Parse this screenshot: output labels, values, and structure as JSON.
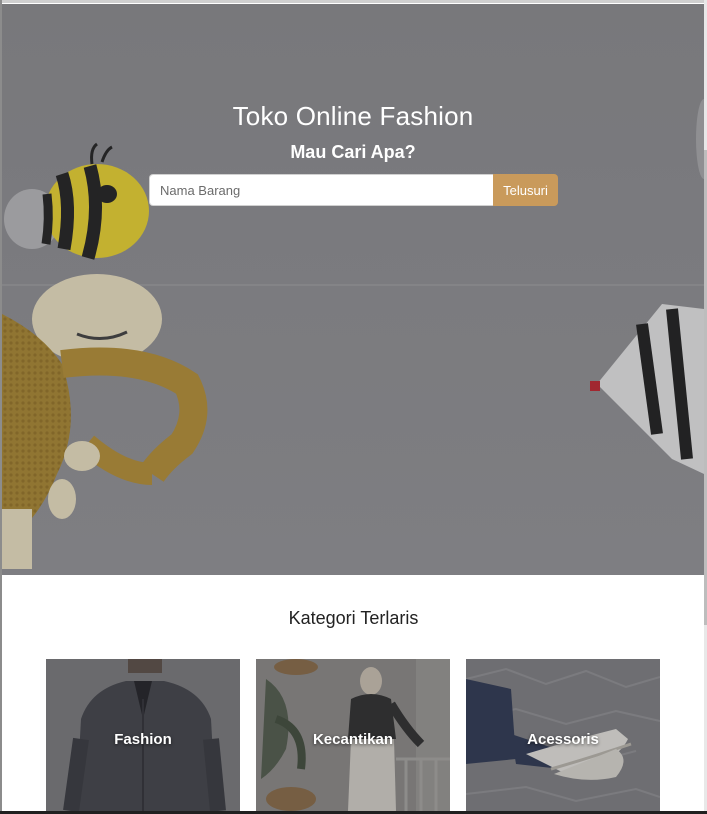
{
  "hero": {
    "title": "Toko Online Fashion",
    "subtitle": "Mau Cari Apa?",
    "search": {
      "placeholder": "Nama Barang",
      "button_label": "Telusuri"
    }
  },
  "categories_section": {
    "title": "Kategori Terlaris",
    "items": [
      {
        "label": "Fashion",
        "image": "man-dark-jacket-photo"
      },
      {
        "label": "Kecantikan",
        "image": "woman-hijab-balcony-photo"
      },
      {
        "label": "Acessoris",
        "image": "sneakers-jeans-pavement-photo"
      }
    ]
  },
  "colors": {
    "accent": "#c99a5b",
    "hero_overlay": "#868689"
  }
}
